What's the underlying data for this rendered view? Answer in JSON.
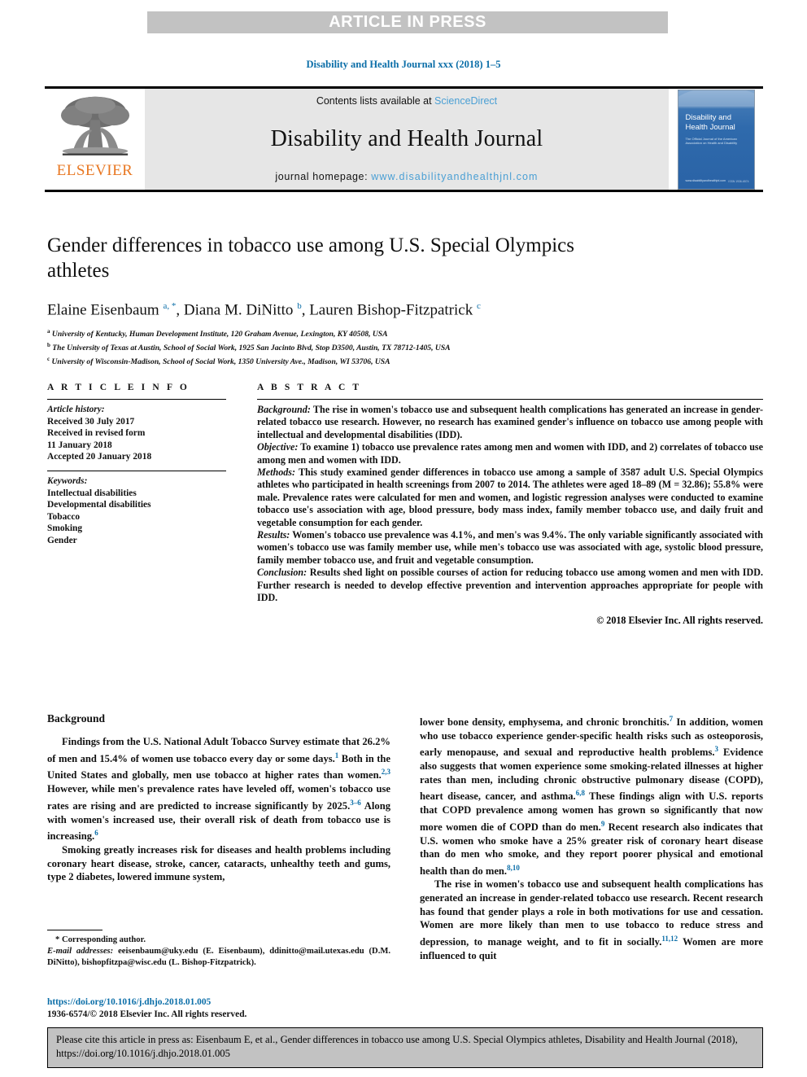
{
  "banner": {
    "text": "ARTICLE IN PRESS"
  },
  "journal_ref": "Disability and Health Journal xxx (2018) 1–5",
  "masthead": {
    "publisher_name": "ELSEVIER",
    "contents_prefix": "Contents lists available at ",
    "contents_link": "ScienceDirect",
    "journal_name": "Disability and Health Journal",
    "homepage_prefix": "journal homepage: ",
    "homepage_url": "www.disabilityandhealthjnl.com",
    "cover": {
      "title_line1": "Disability and",
      "title_line2": "Health Journal",
      "subtitle": "The Official Journal of the American Association on Health and Disability",
      "footer_left": "www.disabilityandhealthjnl.com",
      "footer_right": "ISSN 1936-6574"
    }
  },
  "article": {
    "title": "Gender differences in tobacco use among U.S. Special Olympics athletes",
    "authors": [
      {
        "name": "Elaine Eisenbaum",
        "marks": "a, *"
      },
      {
        "name": "Diana M. DiNitto",
        "marks": "b"
      },
      {
        "name": "Lauren Bishop-Fitzpatrick",
        "marks": "c"
      }
    ],
    "affiliations": [
      {
        "mark": "a",
        "text": "University of Kentucky, Human Development Institute, 120 Graham Avenue, Lexington, KY 40508, USA"
      },
      {
        "mark": "b",
        "text": "The University of Texas at Austin, School of Social Work, 1925 San Jacinto Blvd, Stop D3500, Austin, TX 78712-1405, USA"
      },
      {
        "mark": "c",
        "text": "University of Wisconsin-Madison, School of Social Work, 1350 University Ave., Madison, WI 53706, USA"
      }
    ]
  },
  "article_info": {
    "heading": "A R T I C L E   I N F O",
    "history_label": "Article history:",
    "history": [
      "Received 30 July 2017",
      "Received in revised form",
      "11 January 2018",
      "Accepted 20 January 2018"
    ],
    "keywords_label": "Keywords:",
    "keywords": [
      "Intellectual disabilities",
      "Developmental disabilities",
      "Tobacco",
      "Smoking",
      "Gender"
    ]
  },
  "abstract": {
    "heading": "A B S T R A C T",
    "sections": [
      {
        "label": "Background:",
        "text": " The rise in women's tobacco use and subsequent health complications has generated an increase in gender-related tobacco use research. However, no research has examined gender's influence on tobacco use among people with intellectual and developmental disabilities (IDD)."
      },
      {
        "label": "Objective:",
        "text": " To examine 1) tobacco use prevalence rates among men and women with IDD, and 2) correlates of tobacco use among men and women with IDD."
      },
      {
        "label": "Methods:",
        "text": " This study examined gender differences in tobacco use among a sample of 3587 adult U.S. Special Olympics athletes who participated in health screenings from 2007 to 2014. The athletes were aged 18–89 (M = 32.86); 55.8% were male. Prevalence rates were calculated for men and women, and logistic regression analyses were conducted to examine tobacco use's association with age, blood pressure, body mass index, family member tobacco use, and daily fruit and vegetable consumption for each gender."
      },
      {
        "label": "Results:",
        "text": " Women's tobacco use prevalence was 4.1%, and men's was 9.4%. The only variable significantly associated with women's tobacco use was family member use, while men's tobacco use was associated with age, systolic blood pressure, family member tobacco use, and fruit and vegetable consumption."
      },
      {
        "label": "Conclusion:",
        "text": " Results shed light on possible courses of action for reducing tobacco use among women and men with IDD. Further research is needed to develop effective prevention and intervention approaches appropriate for people with IDD."
      }
    ],
    "copyright": "© 2018 Elsevier Inc. All rights reserved."
  },
  "body": {
    "section_heading": "Background",
    "left_paragraphs": [
      {
        "runs": [
          {
            "t": "Findings from the U.S. National Adult Tobacco Survey estimate that 26.2% of men and 15.4% of women use tobacco every day or some days."
          },
          {
            "t": "1",
            "sup": true
          },
          {
            "t": " Both in the United States and globally, men use tobacco at higher rates than women."
          },
          {
            "t": "2,3",
            "sup": true
          },
          {
            "t": " However, while men's prevalence rates have leveled off, women's tobacco use rates are rising and are predicted to increase significantly by 2025."
          },
          {
            "t": "3–6",
            "sup": true
          },
          {
            "t": " Along with women's increased use, their overall risk of death from tobacco use is increasing."
          },
          {
            "t": "6",
            "sup": true
          }
        ]
      },
      {
        "runs": [
          {
            "t": "Smoking greatly increases risk for diseases and health problems including coronary heart disease, stroke, cancer, cataracts, unhealthy teeth and gums, type 2 diabetes, lowered immune system,"
          }
        ]
      }
    ],
    "right_paragraphs": [
      {
        "runs": [
          {
            "t": "lower bone density, emphysema, and chronic bronchitis.",
            "noindent": true
          },
          {
            "t": "7",
            "sup": true
          },
          {
            "t": " In addition, women who use tobacco experience gender-specific health risks such as osteoporosis, early menopause, and sexual and reproductive health problems."
          },
          {
            "t": "3",
            "sup": true
          },
          {
            "t": " Evidence also suggests that women experience some smoking-related illnesses at higher rates than men, including chronic obstructive pulmonary disease (COPD), heart disease, cancer, and asthma."
          },
          {
            "t": "6,8",
            "sup": true
          },
          {
            "t": " These findings align with U.S. reports that COPD prevalence among women has grown so significantly that now more women die of COPD than do men."
          },
          {
            "t": "9",
            "sup": true
          },
          {
            "t": " Recent research also indicates that U.S. women who smoke have a 25% greater risk of coronary heart disease than do men who smoke, and they report poorer physical and emotional health than do men."
          },
          {
            "t": "8,10",
            "sup": true
          }
        ]
      },
      {
        "runs": [
          {
            "t": "The rise in women's tobacco use and subsequent health complications has generated an increase in gender-related tobacco use research. Recent research has found that gender plays a role in both motivations for use and cessation. Women are more likely than men to use tobacco to reduce stress and depression, to manage weight, and to fit in socially."
          },
          {
            "t": "11,12",
            "sup": true
          },
          {
            "t": " Women are more influenced to quit"
          }
        ]
      }
    ]
  },
  "footnotes": {
    "corresponding": "* Corresponding author.",
    "email_label": "E-mail addresses:",
    "emails": [
      {
        "address": "eeisenbaum@uky.edu",
        "owner": " (E. Eisenbaum), "
      },
      {
        "address": "ddinitto@mail.utexas.edu",
        "owner": " (D.M. DiNitto), "
      },
      {
        "address": "bishopfitzpa@wisc.edu",
        "owner": " (L. Bishop-Fitzpatrick)."
      }
    ],
    "doi": "https://doi.org/10.1016/j.dhjo.2018.01.005",
    "issn": "1936-6574/© 2018 Elsevier Inc. All rights reserved."
  },
  "citation_footer": {
    "text": "Please cite this article in press as: Eisenbaum E, et al., Gender differences in tobacco use among U.S. Special Olympics athletes, Disability and Health Journal (2018), https://doi.org/10.1016/j.dhjo.2018.01.005"
  },
  "colors": {
    "link_blue": "#0b6ea8",
    "light_blue": "#4a9fd4",
    "elsevier_orange": "#e87722",
    "banner_gray": "#c2c2c2",
    "masthead_gray": "#e6e6e6"
  }
}
